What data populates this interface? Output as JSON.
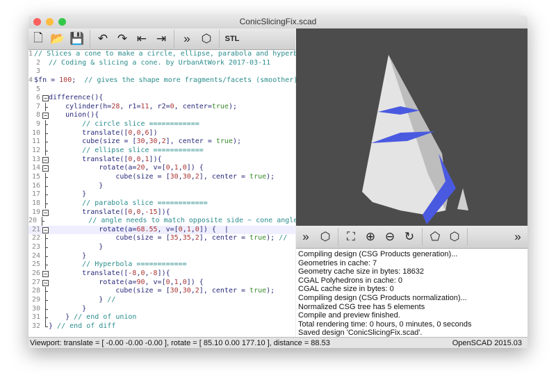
{
  "window": {
    "title": "ConicSlicingFix.scad"
  },
  "colors": {
    "comment": "#2b8c8c",
    "number": "#a33",
    "keyword": "#3a8a2a",
    "code": "#27287a",
    "viewer_bg": "#4c4c4c",
    "slice": "#4a5ae0"
  },
  "toolbar": [
    {
      "icon": "new-file-icon",
      "glyph": "🗋"
    },
    {
      "icon": "open-folder-icon",
      "glyph": "📂"
    },
    {
      "icon": "save-icon",
      "glyph": "💾"
    },
    {
      "icon": "undo-icon",
      "glyph": "↶"
    },
    {
      "icon": "redo-icon",
      "glyph": "↷"
    },
    {
      "icon": "unindent-icon",
      "glyph": "⇤"
    },
    {
      "icon": "indent-icon",
      "glyph": "⇥"
    },
    {
      "icon": "preview-icon",
      "glyph": "»"
    },
    {
      "icon": "render-icon",
      "glyph": "⬡"
    },
    {
      "icon": "export-stl-icon",
      "glyph": "STL"
    }
  ],
  "viewer_toolbar": [
    {
      "icon": "preview-icon",
      "glyph": "»"
    },
    {
      "icon": "render-icon",
      "glyph": "⬡"
    },
    {
      "icon": "view-all-icon",
      "glyph": "⛶"
    },
    {
      "icon": "zoom-in-icon",
      "glyph": "⊕"
    },
    {
      "icon": "zoom-out-icon",
      "glyph": "⊖"
    },
    {
      "icon": "reset-view-icon",
      "glyph": "↻"
    },
    {
      "icon": "perspective-icon",
      "glyph": "⬠"
    },
    {
      "icon": "orthogonal-icon",
      "glyph": "⬡"
    },
    {
      "icon": "more-icon",
      "glyph": "»"
    }
  ],
  "editor": {
    "current_line": 21,
    "lines": [
      [
        [
          "c",
          "// Slices a cone to make a circle, ellipse, parabola and hyperbola"
        ]
      ],
      [
        [
          "c",
          "// Coding & slicing a cone. by UrbanAtWork 2017-03-11"
        ]
      ],
      [],
      [
        [
          "d",
          "$fn = "
        ],
        [
          "n",
          "100"
        ],
        [
          "d",
          ";  "
        ],
        [
          "c",
          "// gives the shape more fragments/facets (smoother)"
        ]
      ],
      [],
      [
        [
          "d",
          "difference(){"
        ]
      ],
      [
        [
          "d",
          "    cylinder(h="
        ],
        [
          "n",
          "28"
        ],
        [
          "d",
          ", r1="
        ],
        [
          "n",
          "11"
        ],
        [
          "d",
          ", r2="
        ],
        [
          "n",
          "0"
        ],
        [
          "d",
          ", center="
        ],
        [
          "k",
          "true"
        ],
        [
          "d",
          ");"
        ]
      ],
      [
        [
          "d",
          "    union(){"
        ]
      ],
      [
        [
          "c",
          "        // circle slice ============"
        ]
      ],
      [
        [
          "d",
          "        translate(["
        ],
        [
          "n",
          "0"
        ],
        [
          "d",
          ","
        ],
        [
          "n",
          "0"
        ],
        [
          "d",
          ","
        ],
        [
          "n",
          "6"
        ],
        [
          "d",
          "])"
        ]
      ],
      [
        [
          "d",
          "        cube(size = ["
        ],
        [
          "n",
          "30"
        ],
        [
          "d",
          ","
        ],
        [
          "n",
          "30"
        ],
        [
          "d",
          ","
        ],
        [
          "n",
          "2"
        ],
        [
          "d",
          "], center = "
        ],
        [
          "k",
          "true"
        ],
        [
          "d",
          ");"
        ]
      ],
      [
        [
          "c",
          "        // ellipse slice ============"
        ]
      ],
      [
        [
          "d",
          "        translate(["
        ],
        [
          "n",
          "0"
        ],
        [
          "d",
          ","
        ],
        [
          "n",
          "0"
        ],
        [
          "d",
          ","
        ],
        [
          "n",
          "1"
        ],
        [
          "d",
          "]){"
        ]
      ],
      [
        [
          "d",
          "            rotate(a="
        ],
        [
          "n",
          "20"
        ],
        [
          "d",
          ", v=["
        ],
        [
          "n",
          "0"
        ],
        [
          "d",
          ","
        ],
        [
          "n",
          "1"
        ],
        [
          "d",
          ","
        ],
        [
          "n",
          "0"
        ],
        [
          "d",
          "]) {"
        ]
      ],
      [
        [
          "d",
          "                cube(size = ["
        ],
        [
          "n",
          "30"
        ],
        [
          "d",
          ","
        ],
        [
          "n",
          "30"
        ],
        [
          "d",
          ","
        ],
        [
          "n",
          "2"
        ],
        [
          "d",
          "], center = "
        ],
        [
          "k",
          "true"
        ],
        [
          "d",
          ");"
        ]
      ],
      [
        [
          "d",
          "            }"
        ]
      ],
      [
        [
          "d",
          "        }"
        ]
      ],
      [
        [
          "c",
          "        // parabola slice ============"
        ]
      ],
      [
        [
          "d",
          "        translate(["
        ],
        [
          "n",
          "0"
        ],
        [
          "d",
          ","
        ],
        [
          "n",
          "0"
        ],
        [
          "d",
          ","
        ],
        [
          "n",
          "-15"
        ],
        [
          "d",
          "]){"
        ]
      ],
      [
        [
          "c",
          "            // angle needs to match opposite side ~ cone angle"
        ]
      ],
      [
        [
          "d",
          "            rotate(a="
        ],
        [
          "n",
          "68.55"
        ],
        [
          "d",
          ", v=["
        ],
        [
          "n",
          "0"
        ],
        [
          "d",
          ","
        ],
        [
          "n",
          "1"
        ],
        [
          "d",
          ","
        ],
        [
          "n",
          "0"
        ],
        [
          "d",
          "]) {  |"
        ]
      ],
      [
        [
          "d",
          "                cube(size = ["
        ],
        [
          "n",
          "35"
        ],
        [
          "d",
          ","
        ],
        [
          "n",
          "35"
        ],
        [
          "d",
          ","
        ],
        [
          "n",
          "2"
        ],
        [
          "d",
          "], center = "
        ],
        [
          "k",
          "true"
        ],
        [
          "d",
          "); "
        ],
        [
          "c",
          "//"
        ]
      ],
      [
        [
          "d",
          "            }"
        ]
      ],
      [
        [
          "d",
          "        }"
        ]
      ],
      [
        [
          "c",
          "        // Hyperbola ============"
        ]
      ],
      [
        [
          "d",
          "        translate(["
        ],
        [
          "n",
          "-8"
        ],
        [
          "d",
          ","
        ],
        [
          "n",
          "0"
        ],
        [
          "d",
          ","
        ],
        [
          "n",
          "-8"
        ],
        [
          "d",
          "]){"
        ]
      ],
      [
        [
          "d",
          "            rotate(a="
        ],
        [
          "n",
          "90"
        ],
        [
          "d",
          ", v=["
        ],
        [
          "n",
          "0"
        ],
        [
          "d",
          ","
        ],
        [
          "n",
          "1"
        ],
        [
          "d",
          ","
        ],
        [
          "n",
          "0"
        ],
        [
          "d",
          "]) {"
        ]
      ],
      [
        [
          "d",
          "                cube(size = ["
        ],
        [
          "n",
          "30"
        ],
        [
          "d",
          ","
        ],
        [
          "n",
          "30"
        ],
        [
          "d",
          ","
        ],
        [
          "n",
          "2"
        ],
        [
          "d",
          "], center = "
        ],
        [
          "k",
          "true"
        ],
        [
          "d",
          ");"
        ]
      ],
      [
        [
          "d",
          "            } "
        ],
        [
          "c",
          "//"
        ]
      ],
      [
        [
          "d",
          "        }"
        ]
      ],
      [
        [
          "d",
          "    } "
        ],
        [
          "c",
          "// end of union"
        ]
      ],
      [
        [
          "d",
          "} "
        ],
        [
          "c",
          "// end of diff"
        ]
      ]
    ],
    "fold_markers": [
      6,
      8,
      13,
      14,
      19,
      21,
      26,
      27
    ]
  },
  "console": [
    "Compiling design (CSG Products generation)...",
    "Geometries in cache: 7",
    "Geometry cache size in bytes: 18632",
    "CGAL Polyhedrons in cache: 0",
    "CGAL cache size in bytes: 0",
    "Compiling design (CSG Products normalization)...",
    "Normalized CSG tree has 5 elements",
    "Compile and preview finished.",
    "Total rendering time: 0 hours, 0 minutes, 0 seconds",
    "Saved design 'ConicSlicingFix.scad'."
  ],
  "status": {
    "viewport": "Viewport: translate = [ -0.00 -0.00 -0.00 ], rotate = [ 85.10 0.00 177.10 ], distance = 88.53",
    "version": "OpenSCAD 2015.03"
  }
}
